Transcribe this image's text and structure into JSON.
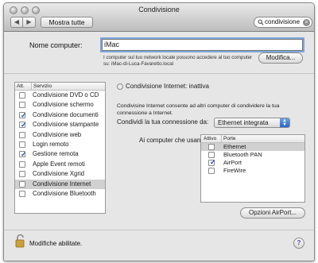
{
  "window": {
    "title": "Condivisione"
  },
  "toolbar": {
    "back": "◀",
    "forward": "▶",
    "show_all": "Mostra tutte"
  },
  "search": {
    "value": "condivisione",
    "clear": "×"
  },
  "computer_name": {
    "label": "Nome computer:",
    "value": "iMac",
    "description": "I computer sul tuo network locale possono accedere al tuo computer su: iMac-di-Luca-Favaretto.local",
    "edit_button": "Modifica..."
  },
  "services": {
    "header_on": "Att.",
    "header_service": "Servizio",
    "items": [
      {
        "label": "Condivisione DVD o CD",
        "checked": false,
        "selected": false
      },
      {
        "label": "Condivisione schermo",
        "checked": false,
        "selected": false
      },
      {
        "label": "Condivisione documenti",
        "checked": true,
        "selected": false
      },
      {
        "label": "Condivisione stampante",
        "checked": true,
        "selected": false
      },
      {
        "label": "Condivisione web",
        "checked": false,
        "selected": false
      },
      {
        "label": "Login remoto",
        "checked": false,
        "selected": false
      },
      {
        "label": "Gestione remota",
        "checked": true,
        "selected": false
      },
      {
        "label": "Apple Event remoti",
        "checked": false,
        "selected": false
      },
      {
        "label": "Condivisione Xgrid",
        "checked": false,
        "selected": false
      },
      {
        "label": "Condivisione Internet",
        "checked": false,
        "selected": true
      },
      {
        "label": "Condivisione Bluetooth",
        "checked": false,
        "selected": false
      }
    ]
  },
  "detail": {
    "status": "Condivisione Internet: inattiva",
    "description": "Condivisine Internet consente ad altri computer di condividere la tua connessione a Internet.",
    "share_label": "Condividi la tua connessione da:",
    "share_value": "Ethernet integrata",
    "computers_label": "Ai computer che usano:",
    "ports_header_on": "Attivo",
    "ports_header_port": "Porte",
    "ports": [
      {
        "label": "Ethernet",
        "checked": false,
        "selected": true
      },
      {
        "label": "Bluetooth PAN",
        "checked": false,
        "selected": false
      },
      {
        "label": "AirPort",
        "checked": true,
        "selected": false
      },
      {
        "label": "FireWire",
        "checked": false,
        "selected": false
      }
    ],
    "airport_button": "Opzioni AirPort..."
  },
  "footer": {
    "lock_text": "Modifiche abilitate.",
    "help": "?"
  }
}
